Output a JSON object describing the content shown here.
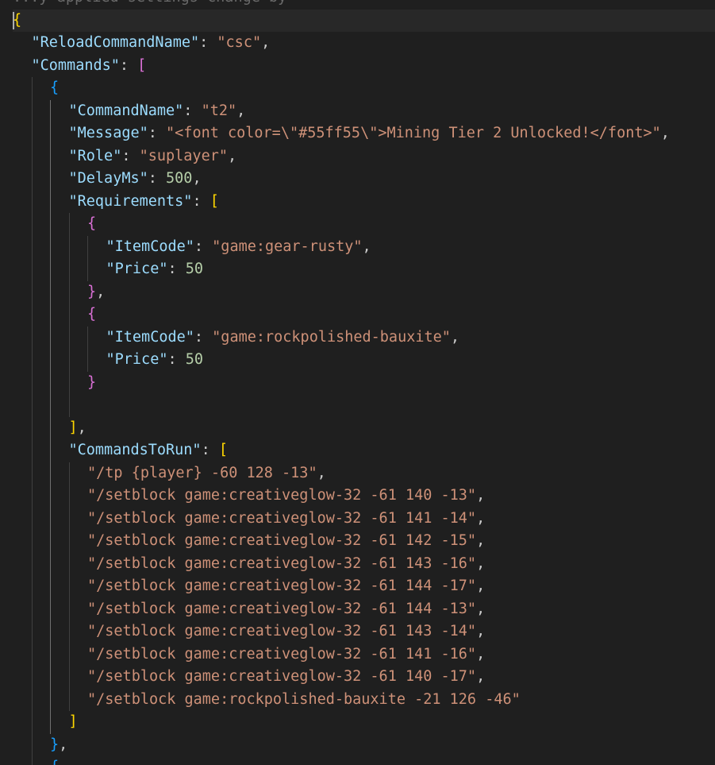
{
  "editor": {
    "partial_top_line": "...y applied settings change by",
    "colors": {
      "background": "#1f1f1f",
      "key": "#9cdcfe",
      "string": "#ce9178",
      "number": "#b5cea8",
      "bracket_level_1": "#ffd700",
      "bracket_level_2": "#da70d6",
      "bracket_level_3": "#179fff"
    },
    "lines": [
      {
        "indent": 0,
        "current": false,
        "tokens": [
          {
            "t": "...y applied settings change by",
            "c": "top-fade"
          }
        ]
      },
      {
        "indent": 0,
        "current": true,
        "tokens": [
          {
            "t": "{",
            "c": "b0"
          }
        ]
      },
      {
        "indent": 1,
        "tokens": [
          {
            "t": "\"ReloadCommandName\"",
            "c": "key"
          },
          {
            "t": ": ",
            "c": "p"
          },
          {
            "t": "\"csc\"",
            "c": "str"
          },
          {
            "t": ",",
            "c": "p"
          }
        ]
      },
      {
        "indent": 1,
        "tokens": [
          {
            "t": "\"Commands\"",
            "c": "key"
          },
          {
            "t": ": ",
            "c": "p"
          },
          {
            "t": "[",
            "c": "b1"
          }
        ]
      },
      {
        "indent": 2,
        "tokens": [
          {
            "t": "{",
            "c": "b2"
          }
        ]
      },
      {
        "indent": 3,
        "tokens": [
          {
            "t": "\"CommandName\"",
            "c": "key"
          },
          {
            "t": ": ",
            "c": "p"
          },
          {
            "t": "\"t2\"",
            "c": "str"
          },
          {
            "t": ",",
            "c": "p"
          }
        ]
      },
      {
        "indent": 3,
        "tokens": [
          {
            "t": "\"Message\"",
            "c": "key"
          },
          {
            "t": ": ",
            "c": "p"
          },
          {
            "t": "\"<font color=\\\"#55ff55\\\">Mining Tier 2 Unlocked!</font>\"",
            "c": "str"
          },
          {
            "t": ",",
            "c": "p"
          }
        ]
      },
      {
        "indent": 3,
        "tokens": [
          {
            "t": "\"Role\"",
            "c": "key"
          },
          {
            "t": ": ",
            "c": "p"
          },
          {
            "t": "\"suplayer\"",
            "c": "str"
          },
          {
            "t": ",",
            "c": "p"
          }
        ]
      },
      {
        "indent": 3,
        "tokens": [
          {
            "t": "\"DelayMs\"",
            "c": "key"
          },
          {
            "t": ": ",
            "c": "p"
          },
          {
            "t": "500",
            "c": "num"
          },
          {
            "t": ",",
            "c": "p"
          }
        ]
      },
      {
        "indent": 3,
        "tokens": [
          {
            "t": "\"Requirements\"",
            "c": "key"
          },
          {
            "t": ": ",
            "c": "p"
          },
          {
            "t": "[",
            "c": "b0"
          }
        ]
      },
      {
        "indent": 4,
        "tokens": [
          {
            "t": "{",
            "c": "b1"
          }
        ]
      },
      {
        "indent": 5,
        "tokens": [
          {
            "t": "\"ItemCode\"",
            "c": "key"
          },
          {
            "t": ": ",
            "c": "p"
          },
          {
            "t": "\"game:gear-rusty\"",
            "c": "str"
          },
          {
            "t": ",",
            "c": "p"
          }
        ]
      },
      {
        "indent": 5,
        "tokens": [
          {
            "t": "\"Price\"",
            "c": "key"
          },
          {
            "t": ": ",
            "c": "p"
          },
          {
            "t": "50",
            "c": "num"
          }
        ]
      },
      {
        "indent": 4,
        "tokens": [
          {
            "t": "}",
            "c": "b1"
          },
          {
            "t": ",",
            "c": "p"
          }
        ]
      },
      {
        "indent": 4,
        "tokens": [
          {
            "t": "{",
            "c": "b1"
          }
        ]
      },
      {
        "indent": 5,
        "tokens": [
          {
            "t": "\"ItemCode\"",
            "c": "key"
          },
          {
            "t": ": ",
            "c": "p"
          },
          {
            "t": "\"game:rockpolished-bauxite\"",
            "c": "str"
          },
          {
            "t": ",",
            "c": "p"
          }
        ]
      },
      {
        "indent": 5,
        "tokens": [
          {
            "t": "\"Price\"",
            "c": "key"
          },
          {
            "t": ": ",
            "c": "p"
          },
          {
            "t": "50",
            "c": "num"
          }
        ]
      },
      {
        "indent": 4,
        "tokens": [
          {
            "t": "}",
            "c": "b1"
          }
        ]
      },
      {
        "indent": 4,
        "tokens": []
      },
      {
        "indent": 3,
        "tokens": [
          {
            "t": "]",
            "c": "b0"
          },
          {
            "t": ",",
            "c": "p"
          }
        ]
      },
      {
        "indent": 3,
        "tokens": [
          {
            "t": "\"CommandsToRun\"",
            "c": "key"
          },
          {
            "t": ": ",
            "c": "p"
          },
          {
            "t": "[",
            "c": "b0"
          }
        ]
      },
      {
        "indent": 4,
        "tokens": [
          {
            "t": "\"/tp {player} -60 128 -13\"",
            "c": "str"
          },
          {
            "t": ",",
            "c": "p"
          }
        ]
      },
      {
        "indent": 4,
        "tokens": [
          {
            "t": "\"/setblock game:creativeglow-32 -61 140 -13\"",
            "c": "str"
          },
          {
            "t": ",",
            "c": "p"
          }
        ]
      },
      {
        "indent": 4,
        "tokens": [
          {
            "t": "\"/setblock game:creativeglow-32 -61 141 -14\"",
            "c": "str"
          },
          {
            "t": ",",
            "c": "p"
          }
        ]
      },
      {
        "indent": 4,
        "tokens": [
          {
            "t": "\"/setblock game:creativeglow-32 -61 142 -15\"",
            "c": "str"
          },
          {
            "t": ",",
            "c": "p"
          }
        ]
      },
      {
        "indent": 4,
        "tokens": [
          {
            "t": "\"/setblock game:creativeglow-32 -61 143 -16\"",
            "c": "str"
          },
          {
            "t": ",",
            "c": "p"
          }
        ]
      },
      {
        "indent": 4,
        "tokens": [
          {
            "t": "\"/setblock game:creativeglow-32 -61 144 -17\"",
            "c": "str"
          },
          {
            "t": ",",
            "c": "p"
          }
        ]
      },
      {
        "indent": 4,
        "tokens": [
          {
            "t": "\"/setblock game:creativeglow-32 -61 144 -13\"",
            "c": "str"
          },
          {
            "t": ",",
            "c": "p"
          }
        ]
      },
      {
        "indent": 4,
        "tokens": [
          {
            "t": "\"/setblock game:creativeglow-32 -61 143 -14\"",
            "c": "str"
          },
          {
            "t": ",",
            "c": "p"
          }
        ]
      },
      {
        "indent": 4,
        "tokens": [
          {
            "t": "\"/setblock game:creativeglow-32 -61 141 -16\"",
            "c": "str"
          },
          {
            "t": ",",
            "c": "p"
          }
        ]
      },
      {
        "indent": 4,
        "tokens": [
          {
            "t": "\"/setblock game:creativeglow-32 -61 140 -17\"",
            "c": "str"
          },
          {
            "t": ",",
            "c": "p"
          }
        ]
      },
      {
        "indent": 4,
        "tokens": [
          {
            "t": "\"/setblock game:rockpolished-bauxite -21 126 -46\"",
            "c": "str"
          }
        ]
      },
      {
        "indent": 3,
        "tokens": [
          {
            "t": "]",
            "c": "b0"
          }
        ]
      },
      {
        "indent": 2,
        "tokens": [
          {
            "t": "}",
            "c": "b2"
          },
          {
            "t": ",",
            "c": "p"
          }
        ]
      },
      {
        "indent": 2,
        "tokens": [
          {
            "t": "{",
            "c": "b2"
          }
        ]
      }
    ]
  }
}
